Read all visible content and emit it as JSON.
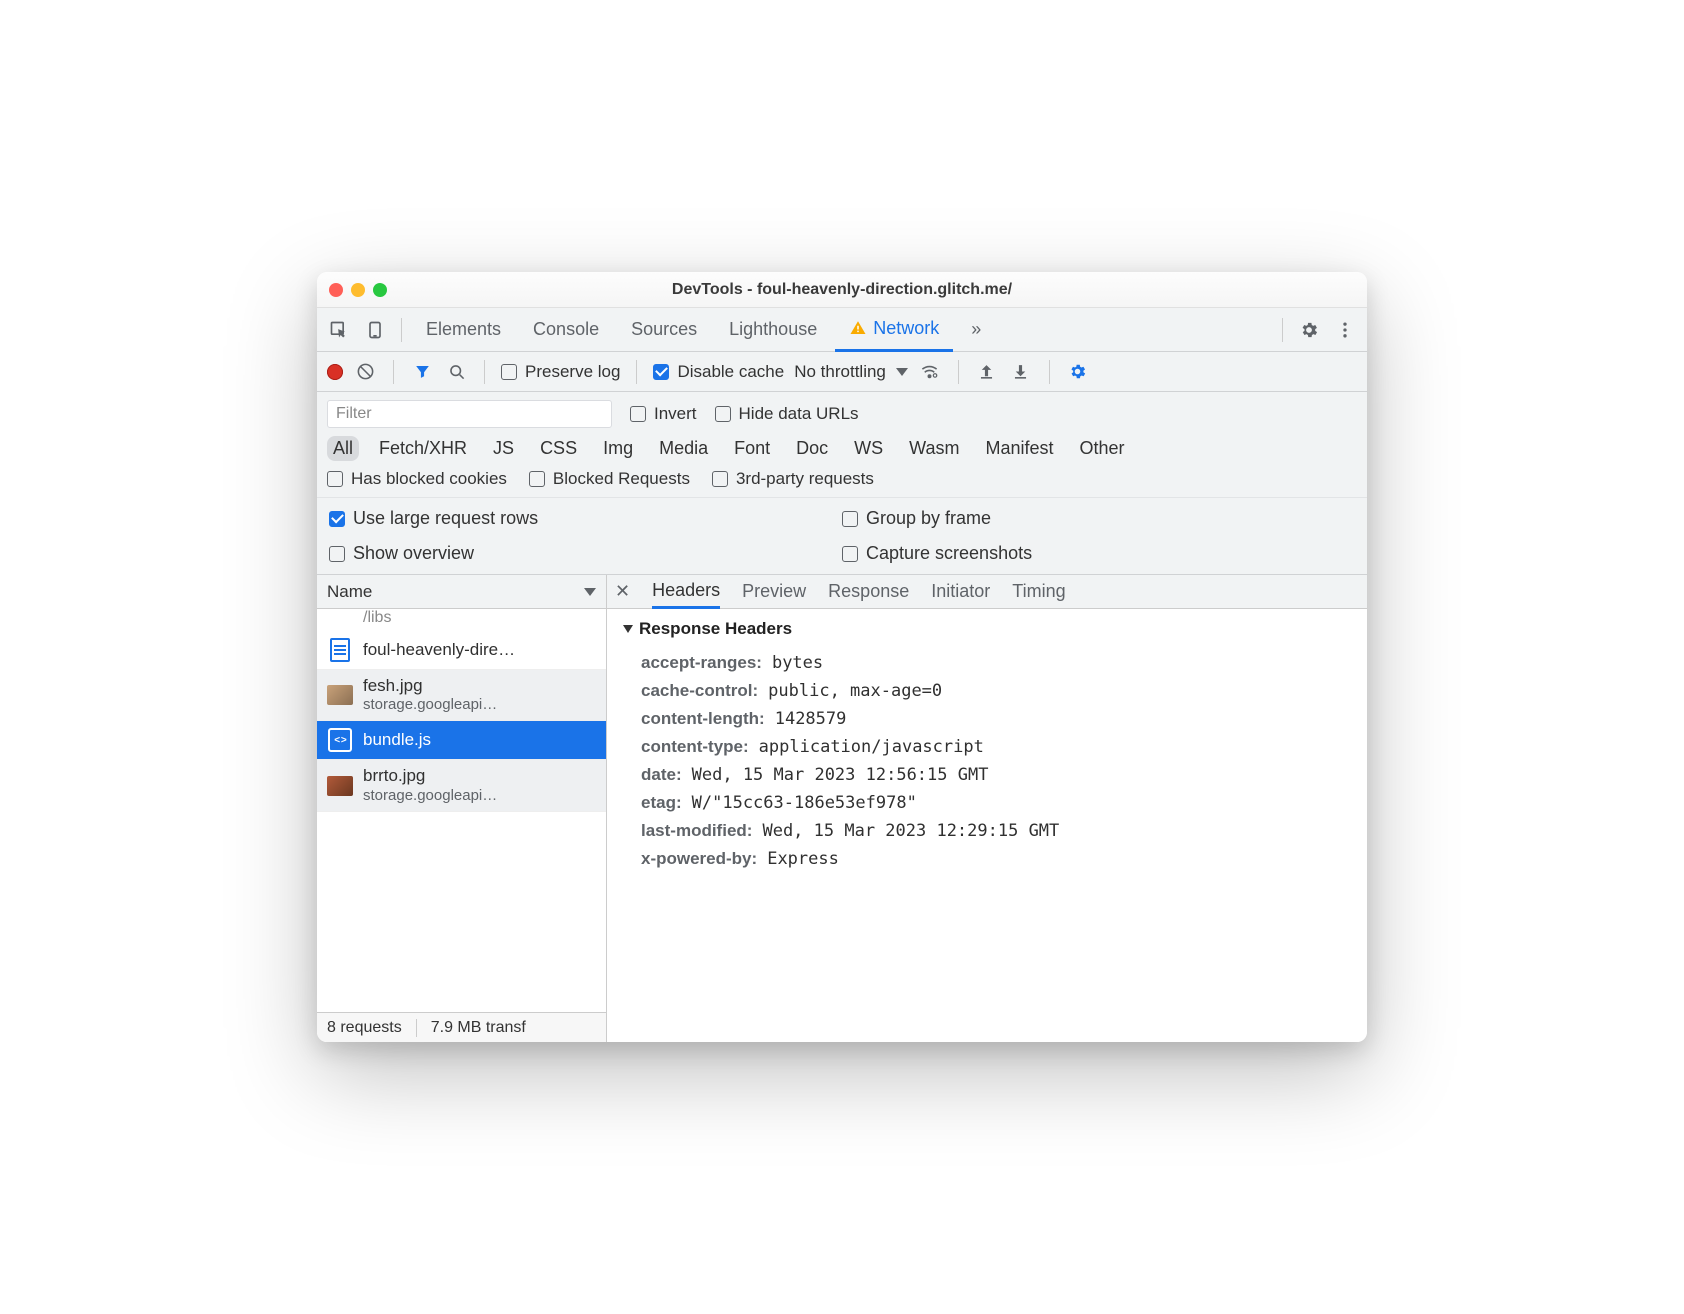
{
  "window": {
    "title": "DevTools - foul-heavenly-direction.glitch.me/"
  },
  "tabs": {
    "elements": "Elements",
    "console": "Console",
    "sources": "Sources",
    "lighthouse": "Lighthouse",
    "network": "Network",
    "more": "»"
  },
  "toolbar": {
    "preserve_log": "Preserve log",
    "disable_cache": "Disable cache",
    "throttling": "No throttling"
  },
  "filter": {
    "placeholder": "Filter",
    "invert": "Invert",
    "hide_data_urls": "Hide data URLs",
    "types": [
      "All",
      "Fetch/XHR",
      "JS",
      "CSS",
      "Img",
      "Media",
      "Font",
      "Doc",
      "WS",
      "Wasm",
      "Manifest",
      "Other"
    ],
    "blocked_cookies": "Has blocked cookies",
    "blocked_requests": "Blocked Requests",
    "third_party": "3rd-party requests"
  },
  "settings": {
    "large_rows": "Use large request rows",
    "group_by_frame": "Group by frame",
    "show_overview": "Show overview",
    "capture_screenshots": "Capture screenshots"
  },
  "list": {
    "header": "Name",
    "partial_top": "/libs",
    "items": [
      {
        "name": "foul-heavenly-dire…",
        "sub": "",
        "icon": "doc"
      },
      {
        "name": "fesh.jpg",
        "sub": "storage.googleapi…",
        "icon": "imgA"
      },
      {
        "name": "bundle.js",
        "sub": "",
        "icon": "js",
        "selected": true
      },
      {
        "name": "brrto.jpg",
        "sub": "storage.googleapi…",
        "icon": "imgB"
      }
    ]
  },
  "status": {
    "requests": "8 requests",
    "transfer": "7.9 MB transf"
  },
  "detail": {
    "tabs": [
      "Headers",
      "Preview",
      "Response",
      "Initiator",
      "Timing"
    ],
    "section": "Response Headers",
    "headers": [
      {
        "k": "accept-ranges",
        "v": "bytes"
      },
      {
        "k": "cache-control",
        "v": "public, max-age=0"
      },
      {
        "k": "content-length",
        "v": "1428579"
      },
      {
        "k": "content-type",
        "v": "application/javascript"
      },
      {
        "k": "date",
        "v": "Wed, 15 Mar 2023 12:56:15 GMT"
      },
      {
        "k": "etag",
        "v": "W/\"15cc63-186e53ef978\""
      },
      {
        "k": "last-modified",
        "v": "Wed, 15 Mar 2023 12:29:15 GMT"
      },
      {
        "k": "x-powered-by",
        "v": "Express"
      }
    ]
  }
}
